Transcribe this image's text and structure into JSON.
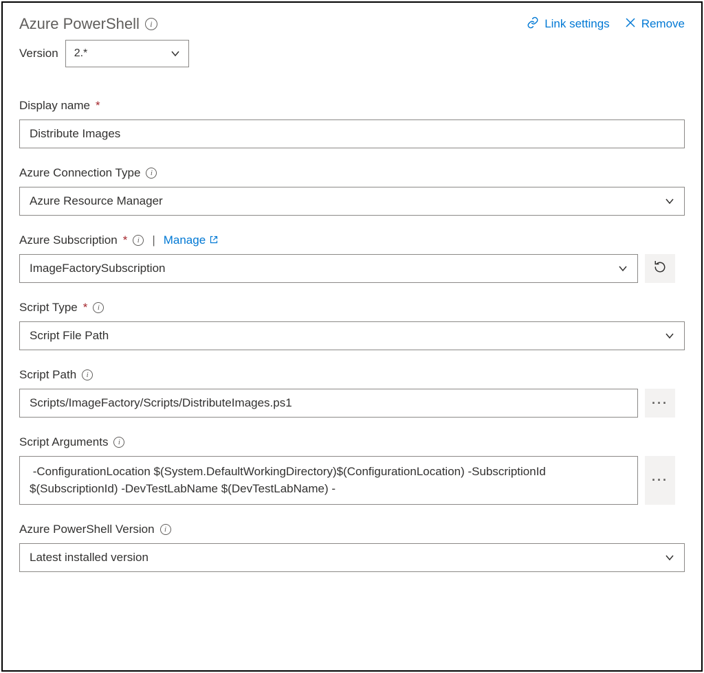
{
  "header": {
    "title": "Azure PowerShell",
    "link_settings": "Link settings",
    "remove": "Remove"
  },
  "version": {
    "label": "Version",
    "value": "2.*"
  },
  "fields": {
    "display_name": {
      "label": "Display name",
      "value": "Distribute Images"
    },
    "connection_type": {
      "label": "Azure Connection Type",
      "value": "Azure Resource Manager"
    },
    "subscription": {
      "label": "Azure Subscription",
      "manage": "Manage",
      "value": "ImageFactorySubscription"
    },
    "script_type": {
      "label": "Script Type",
      "value": "Script File Path"
    },
    "script_path": {
      "label": "Script Path",
      "value": "Scripts/ImageFactory/Scripts/DistributeImages.ps1"
    },
    "script_args": {
      "label": "Script Arguments",
      "value": " -ConfigurationLocation $(System.DefaultWorkingDirectory)$(ConfigurationLocation) -SubscriptionId $(SubscriptionId) -DevTestLabName $(DevTestLabName) -"
    },
    "ps_version": {
      "label": "Azure PowerShell Version",
      "value": "Latest installed version"
    }
  }
}
